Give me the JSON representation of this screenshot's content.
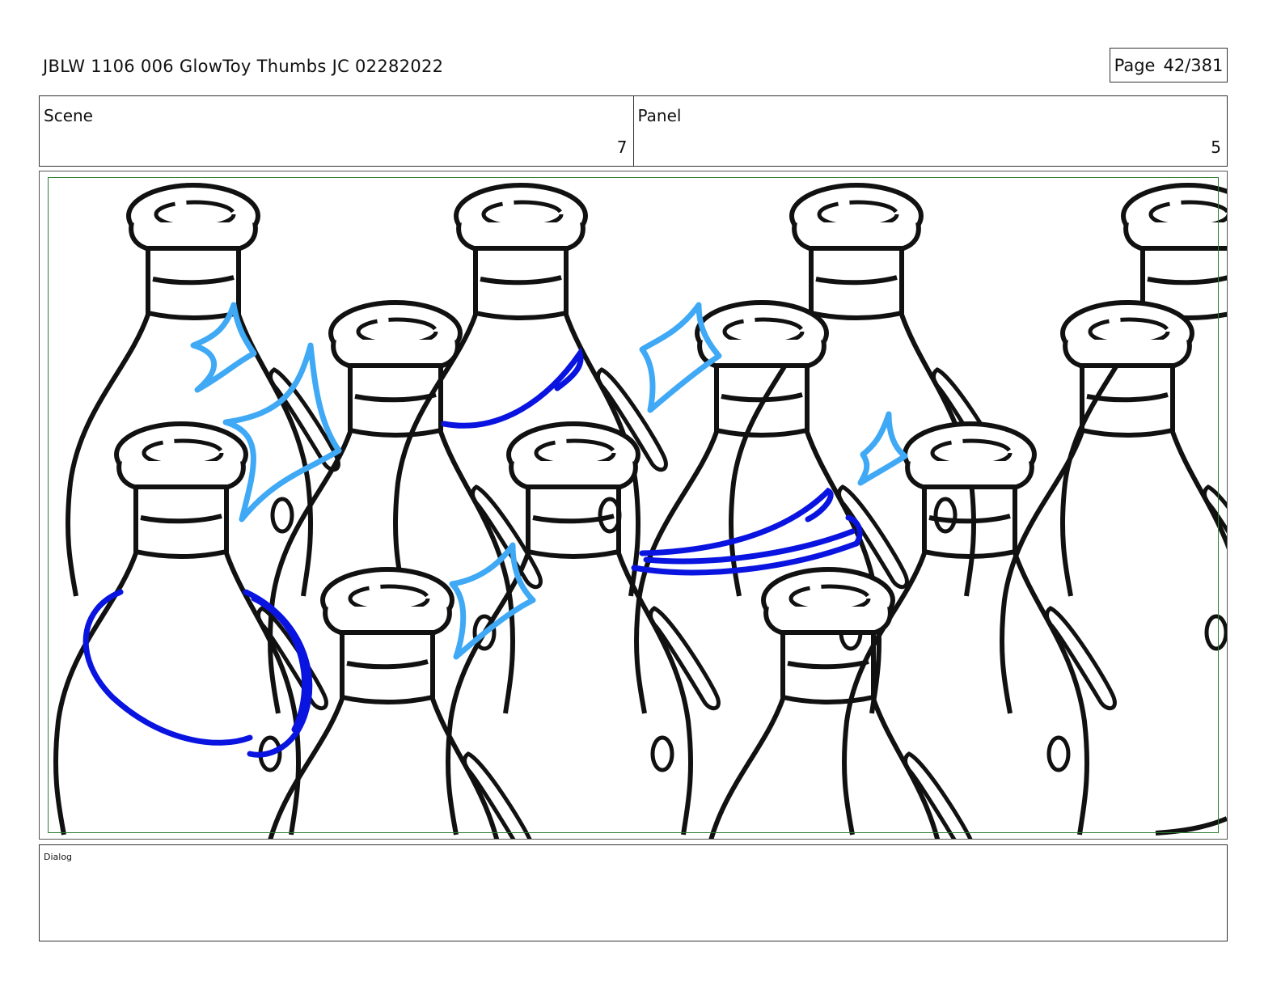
{
  "document": {
    "title": "JBLW 1106 006 GlowToy Thumbs JC 02282022",
    "page_label": "Page",
    "page_number": "42/381"
  },
  "header": {
    "scene_label": "Scene",
    "scene_value": "7",
    "panel_label": "Panel",
    "panel_value": "5"
  },
  "frame": {
    "subject": "sketch-bottles",
    "colors": {
      "ink": "#111111",
      "sparkle": "#3fa9f5",
      "swoosh": "#0a14e0",
      "safe_area": "#2e7d32"
    }
  },
  "dialog": {
    "label": "Dialog",
    "text": ""
  }
}
